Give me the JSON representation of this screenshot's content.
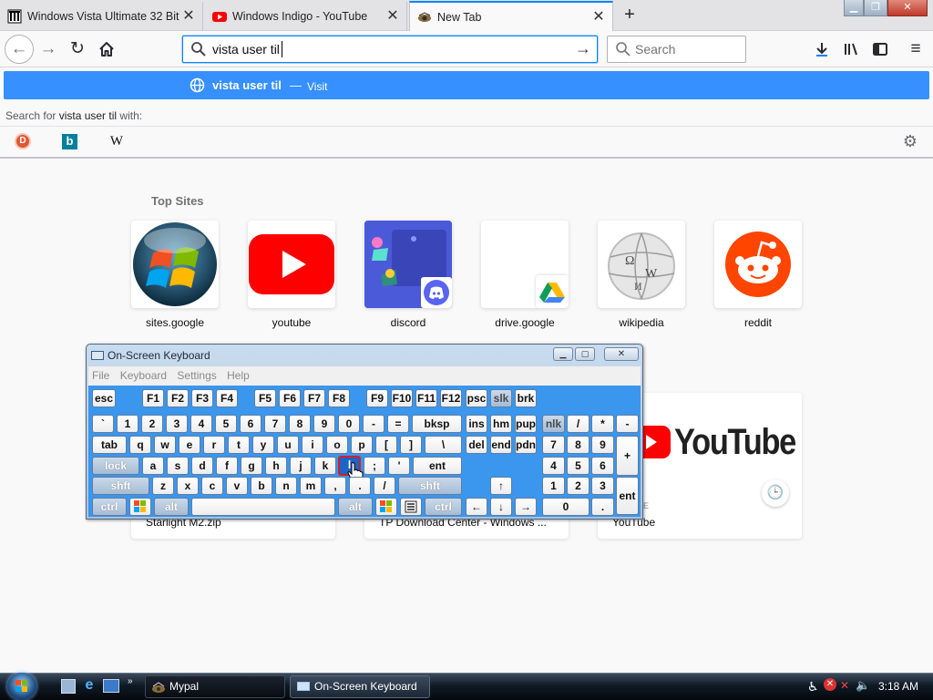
{
  "tabs": [
    {
      "title": "Windows Vista Ultimate 32 Bit :",
      "favicon": "archive-icon"
    },
    {
      "title": "Windows Indigo - YouTube",
      "favicon": "youtube-icon"
    },
    {
      "title": "New Tab",
      "favicon": "newtab-icon"
    }
  ],
  "url": {
    "value": "vista user til",
    "search_placeholder": "Search"
  },
  "suggestion": {
    "text": "vista user til",
    "dash": "—",
    "action": "Visit"
  },
  "search_with": {
    "prefix": "Search for ",
    "query": "vista user til",
    "suffix": " with:"
  },
  "engines": [
    {
      "name": "DuckDuckGo",
      "glyph": "D"
    },
    {
      "name": "Bing",
      "glyph": "b"
    },
    {
      "name": "Wikipedia",
      "glyph": "W"
    }
  ],
  "top_sites": {
    "heading": "Top Sites",
    "sites": [
      {
        "label": "sites.google"
      },
      {
        "label": "youtube"
      },
      {
        "label": "discord"
      },
      {
        "label": "drive.google"
      },
      {
        "label": "wikipedia"
      },
      {
        "label": "reddit"
      }
    ]
  },
  "highlights": [
    {
      "caption": "Starlight M2.zip"
    },
    {
      "caption": "TP Download Center - Windows ..."
    },
    {
      "caption": "YouTube",
      "logo_word": "YouTube",
      "source_fragment": "BE"
    }
  ],
  "osk": {
    "title": "On-Screen Keyboard",
    "menu": [
      "File",
      "Keyboard",
      "Settings",
      "Help"
    ],
    "keys": {
      "esc": "esc",
      "f": [
        "F1",
        "F2",
        "F3",
        "F4",
        "F5",
        "F6",
        "F7",
        "F8",
        "F9",
        "F10",
        "F11",
        "F12"
      ],
      "psc": "psc",
      "slk": "slk",
      "brk": "brk",
      "num_row": [
        "`",
        "1",
        "2",
        "3",
        "4",
        "5",
        "6",
        "7",
        "8",
        "9",
        "0",
        "-",
        "="
      ],
      "bksp": "bksp",
      "ins": "ins",
      "hm": "hm",
      "pup": "pup",
      "nlk": "nlk",
      "div": "/",
      "mul": "*",
      "sub": "-",
      "tab": "tab",
      "q_row": [
        "q",
        "w",
        "e",
        "r",
        "t",
        "y",
        "u",
        "i",
        "o",
        "p",
        "[",
        "]",
        "\\"
      ],
      "del": "del",
      "end": "end",
      "pdn": "pdn",
      "n7": "7",
      "n8": "8",
      "n9": "9",
      "add": "+",
      "lock": "lock",
      "a_row": [
        "a",
        "s",
        "d",
        "f",
        "g",
        "h",
        "j",
        "k",
        "l",
        ";",
        "'"
      ],
      "ent": "ent",
      "n4": "4",
      "n5": "5",
      "n6": "6",
      "shft": "shft",
      "z_row": [
        "z",
        "x",
        "c",
        "v",
        "b",
        "n",
        "m",
        ",",
        ".",
        "/"
      ],
      "up": "↑",
      "n1": "1",
      "n2": "2",
      "n3": "3",
      "nent": "ent",
      "ctrl": "ctrl",
      "alt": "alt",
      "left": "←",
      "down": "↓",
      "right": "→",
      "n0": "0",
      "ndot": "."
    }
  },
  "taskbar": {
    "items": [
      {
        "label": "Mypal"
      },
      {
        "label": "On-Screen Keyboard"
      }
    ],
    "clock": "3:18 AM"
  },
  "colors": {
    "accent": "#0a84ff",
    "suggestion": "#3690ff",
    "osk_panel": "#3b96ee",
    "youtube": "#ff0000",
    "reddit": "#ff4500"
  }
}
